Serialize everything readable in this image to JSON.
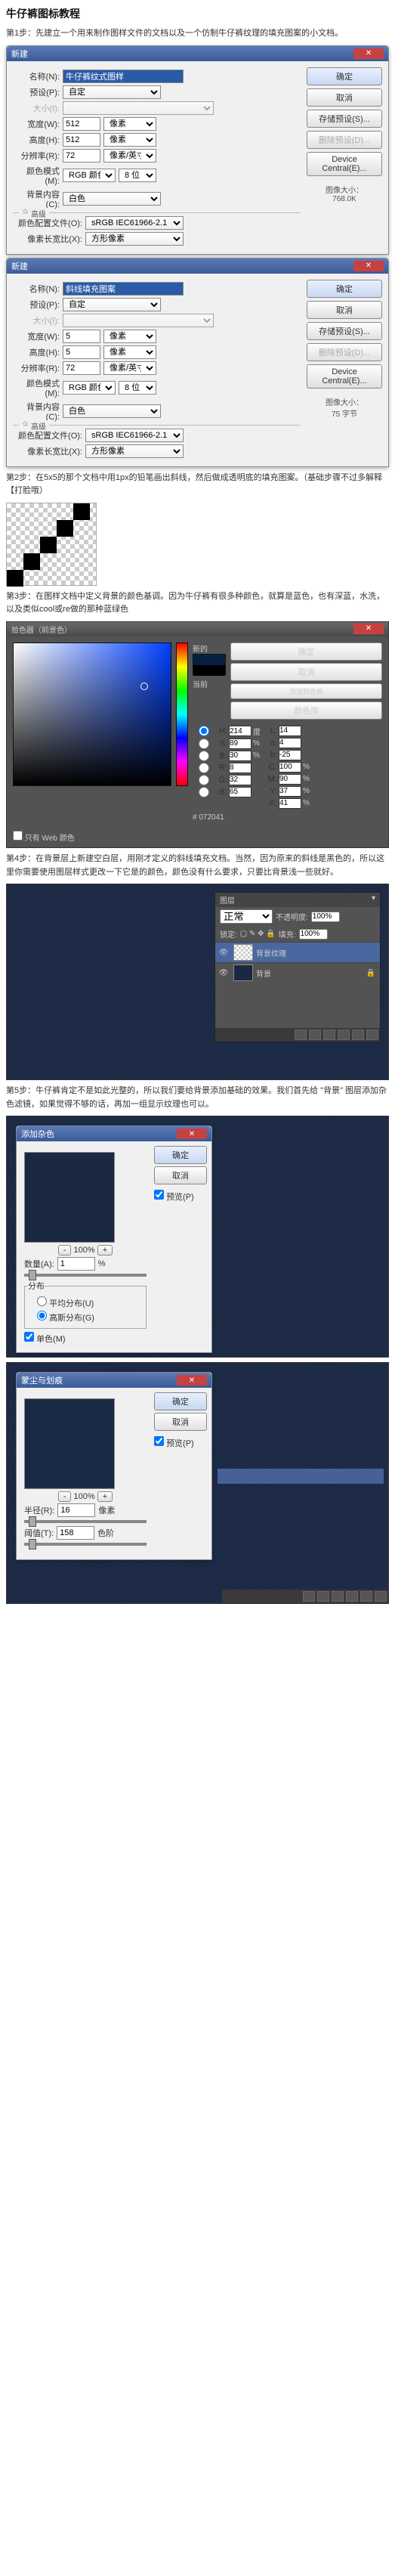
{
  "title": "牛仔裤图标教程",
  "steps": {
    "s1": "第1步：先建立一个用来制作图样文件的文档以及一个仿制牛仔裤纹理的填充图案的小文档。",
    "s2": "第2步：在5x5的那个文档中用1px的铅笔画出斜线，然后做成透明底的填充图案。（基础步骤不过多解释【打脸哦）",
    "s3": "第3步：在图样文档中定义背景的颜色基调。因为牛仔裤有很多种颜色，就算是蓝色，也有深蓝，水洗，以及类似cool或re做的那种蓝绿色",
    "s4": "第4步：在背景层上新建空白层，用刚才定义的斜线填充文档。当然，因为原来的斜线是黑色的，所以这里你需要使用图层样式更改一下它是的颜色，颜色没有什么要求，只要比背景浅一些就好。",
    "s5": "第5步：牛仔裤肯定不是如此光整的，所以我们要给背景添加基础的效果。我们首先给 \"背景\" 图层添加杂色滤镜，如果觉得不够的话，再加一组显示纹理也可以。"
  },
  "dlg_new": {
    "title": "新建",
    "close": "✕",
    "name_lbl": "名称(N):",
    "name1": "牛仔裤纹式图样",
    "name2": "斜线填充图案",
    "preset_lbl": "预设(P):",
    "preset": "自定",
    "size_lbl": "大小(I):",
    "w_lbl": "宽度(W):",
    "w1": "512",
    "w2": "5",
    "h_lbl": "高度(H):",
    "h1": "512",
    "h2": "5",
    "res_lbl": "分辨率(R):",
    "res": "72",
    "mode_lbl": "颜色模式(M):",
    "mode": "RGB 颜色",
    "bit": "8 位",
    "bg_lbl": "背景内容(C):",
    "bg1": "白色",
    "adv": "高级",
    "profile_lbl": "颜色配置文件(O):",
    "profile": "sRGB IEC61966-2.1",
    "aspect_lbl": "像素长宽比(X):",
    "aspect": "方形像素",
    "unit_px": "像素",
    "unit_ppi": "像素/英寸",
    "ok": "确定",
    "cancel": "取消",
    "save_preset": "存储预设(S)...",
    "del_preset": "删除预设(D)...",
    "dcentral": "Device Central(E)...",
    "size_title": "图像大小：",
    "size1": "768.0K",
    "size2": "75 字节"
  },
  "cp": {
    "title": "拾色器（前景色）",
    "ok": "确定",
    "cancel": "取消",
    "addsw": "添加到色板",
    "lib": "颜色库",
    "new": "新的",
    "cur": "当前",
    "webonly": "只有 Web 颜色",
    "H": "214",
    "S": "89",
    "B": "30",
    "R": "8",
    "G": "32",
    "Bb": "65",
    "L": "14",
    "a": "4",
    "b": "-25",
    "C": "100",
    "M": "90",
    "Y": "37",
    "K": "41",
    "hex": "# 072041"
  },
  "layers": {
    "title": "图层",
    "mode": "正常",
    "opacity_lbl": "不透明度:",
    "opacity": "100%",
    "lock_lbl": "锁定:",
    "fill_lbl": "填充:",
    "fill": "100%",
    "layer1": "背景纹理",
    "layer2": "背景",
    "lock_icon": "🔒"
  },
  "noise": {
    "title": "添加杂色",
    "ok": "确定",
    "cancel": "取消",
    "preview": "预览(P)",
    "zoom": "100%",
    "amount_lbl": "数量(A):",
    "amount": "1",
    "pct": "%",
    "dist": "分布",
    "uniform": "平均分布(U)",
    "gaussian": "高斯分布(G)",
    "mono": "单色(M)"
  },
  "clouds": {
    "title": "蒙尘与划痕",
    "ok": "确定",
    "cancel": "取消",
    "preview": "预览(P)",
    "zoom": "100%",
    "radius_lbl": "半径(R):",
    "radius": "16",
    "px": "像素",
    "thresh_lbl": "阈值(T):",
    "thresh": "158",
    "level": "色阶"
  }
}
